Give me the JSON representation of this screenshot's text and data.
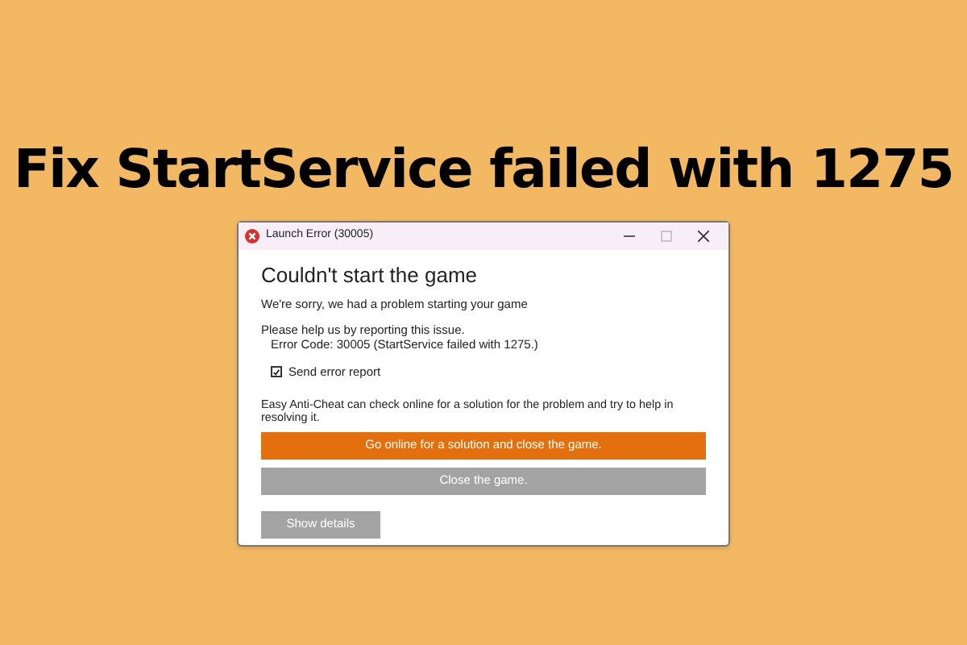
{
  "headline": "Fix StartService failed with 1275",
  "window": {
    "title": "Launch Error (30005)"
  },
  "heading": "Couldn't start the game",
  "subtitle": "We're sorry, we had a problem starting your game",
  "help_text": "Please help us by reporting this issue.",
  "error_code": "Error Code: 30005 (StartService failed with 1275.)",
  "checkbox": {
    "label": "Send error report",
    "checked": true
  },
  "info": "Easy Anti-Cheat can check online for a solution for the problem and try to help in resolving it.",
  "buttons": [
    {
      "label": "Go online for a solution and close the game.",
      "kind": "primary"
    },
    {
      "label": "Close the game.",
      "kind": "secondary"
    }
  ],
  "details_button": "Show details"
}
